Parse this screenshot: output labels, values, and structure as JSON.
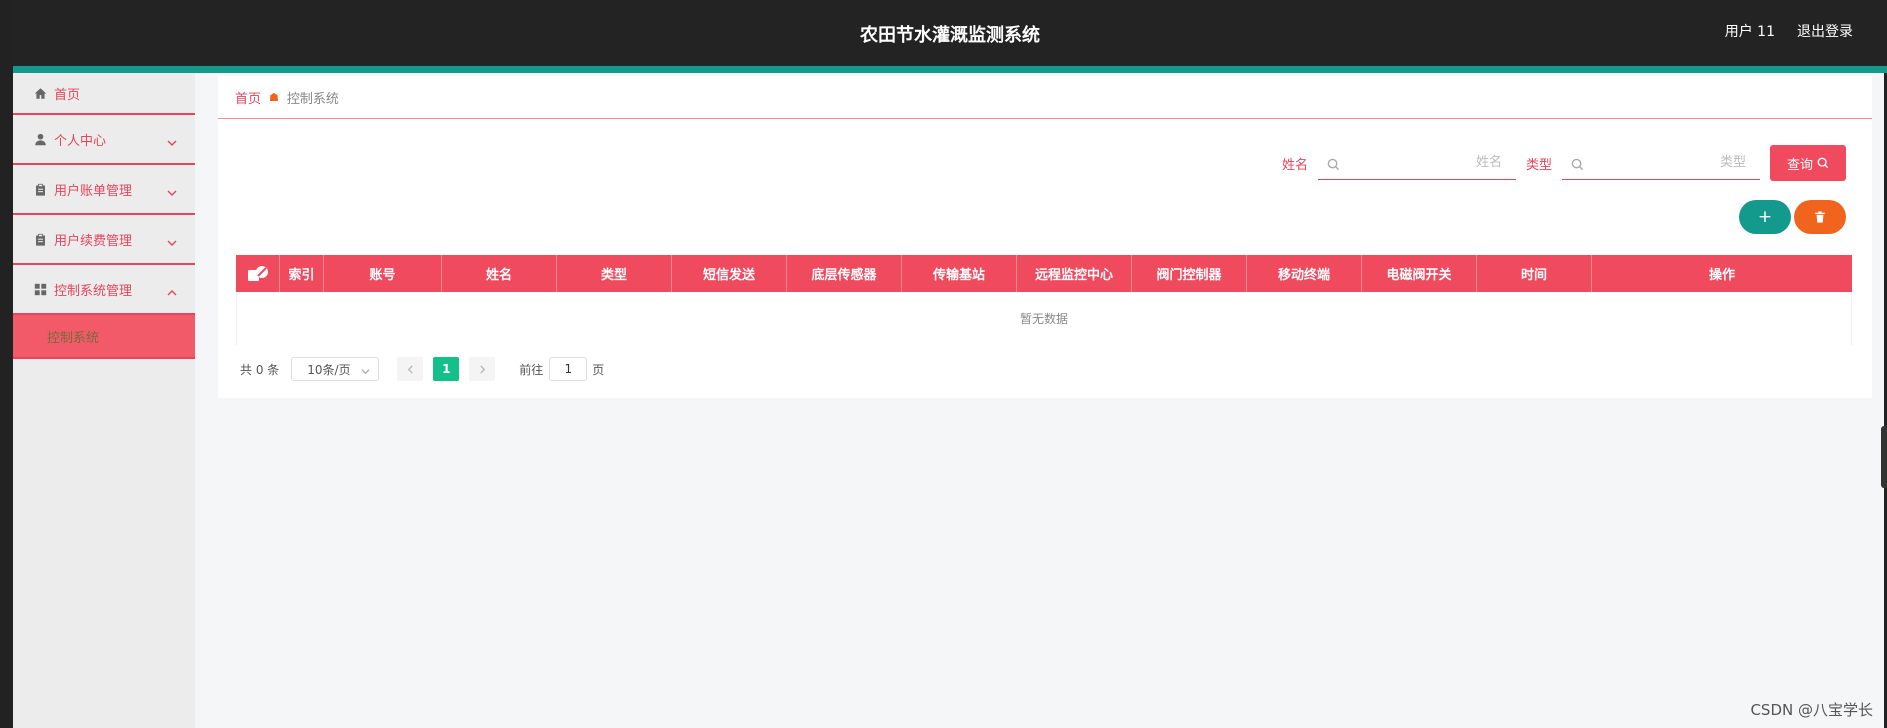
{
  "header": {
    "title": "农田节水灌溉监测系统",
    "user": "用户 11",
    "logout": "退出登录",
    "accent_color": "#139a8c"
  },
  "sidebar": {
    "items": [
      {
        "label": "首页",
        "icon": "home-icon"
      },
      {
        "label": "个人中心",
        "icon": "user-icon"
      },
      {
        "label": "用户账单管理",
        "icon": "clipboard-icon"
      },
      {
        "label": "用户续费管理",
        "icon": "clipboard-icon"
      },
      {
        "label": "控制系统管理",
        "icon": "grid-icon"
      }
    ],
    "subitem": "控制系统",
    "accent_color": "#e4455c"
  },
  "breadcrumb": {
    "home": "首页",
    "current": "控制系统"
  },
  "search": {
    "name_label": "姓名",
    "name_placeholder": "姓名",
    "type_label": "类型",
    "type_placeholder": "类型",
    "query_button": "查询"
  },
  "actions": {
    "add_label": "+"
  },
  "table": {
    "columns": [
      "索引",
      "账号",
      "姓名",
      "类型",
      "短信发送",
      "底层传感器",
      "传输基站",
      "远程监控中心",
      "阀门控制器",
      "移动终端",
      "电磁阀开关",
      "时间",
      "操作"
    ],
    "empty_text": "暂无数据",
    "header_color": "#f04a5f"
  },
  "pagination": {
    "total": "共 0 条",
    "page_size": "10条/页",
    "current_page": "1",
    "goto_label": "前往",
    "goto_value": "1",
    "page_suffix": "页"
  },
  "watermark": "CSDN @八宝学长"
}
